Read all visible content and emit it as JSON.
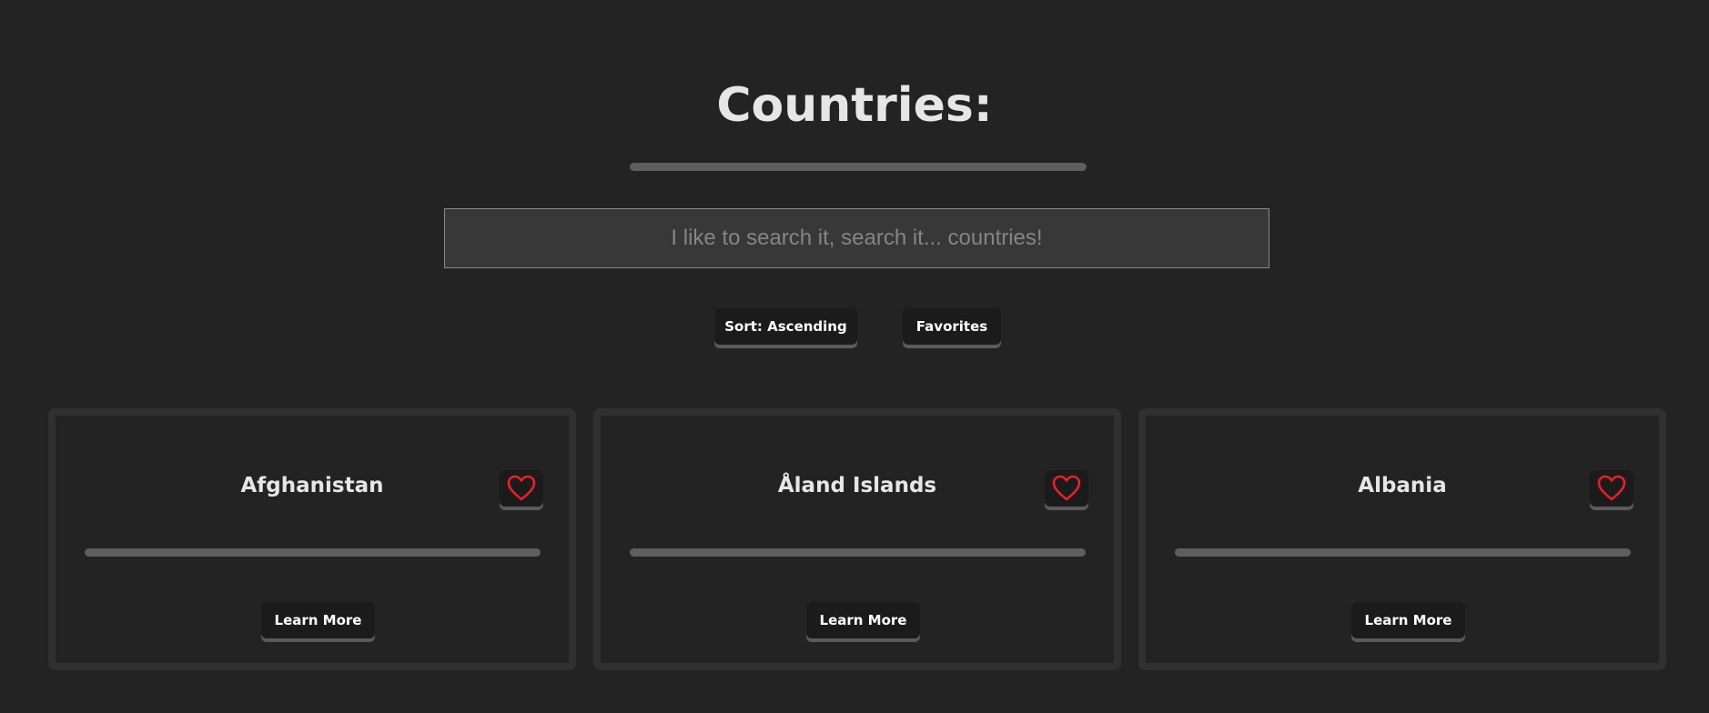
{
  "header": {
    "title": "Countries:"
  },
  "search": {
    "placeholder": "I like to search it, search it... countries!",
    "value": ""
  },
  "controls": {
    "sort_label": "Sort: Ascending",
    "favorites_label": "Favorites"
  },
  "cards": [
    {
      "name": "Afghanistan",
      "learn_more_label": "Learn More",
      "favorite_icon": "heart-outline-icon"
    },
    {
      "name": "Åland Islands",
      "learn_more_label": "Learn More",
      "favorite_icon": "heart-outline-icon"
    },
    {
      "name": "Albania",
      "learn_more_label": "Learn More",
      "favorite_icon": "heart-outline-icon"
    }
  ],
  "colors": {
    "background": "#232323",
    "heart": "#e8202a",
    "button_bg": "#1b1b1b",
    "divider": "#5e5e5e"
  }
}
